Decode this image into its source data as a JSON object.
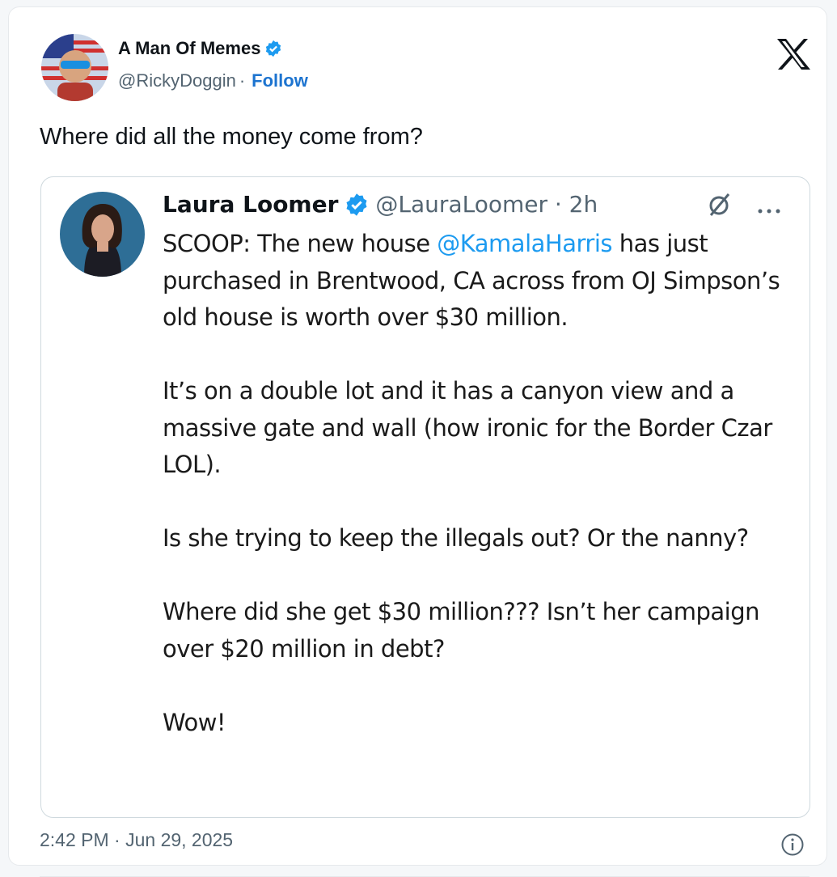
{
  "main_tweet": {
    "author_name": "A Man Of Memes",
    "handle": "@RickyDoggin",
    "separator": "·",
    "follow_label": "Follow",
    "text": "Where did all the money come from?",
    "timestamp": "2:42 PM · Jun 29, 2025"
  },
  "quoted_tweet": {
    "author_name": "Laura Loomer",
    "handle_time": "@LauraLoomer · 2h",
    "body_line1_prefix": "SCOOP: The new house ",
    "mention": "@KamalaHarris",
    "body_line1_suffix": " has",
    "body_para1_rest": "just purchased in Brentwood, CA across from OJ Simpson’s old house is worth over $30 million.",
    "body_para2": "It’s on a double lot and it has a canyon view and a massive gate and wall (how ironic for the Border Czar LOL).",
    "body_para3": "Is she trying to keep the illegals out? Or the nanny?",
    "body_para4": "Where did she get $30 million??? Isn’t her campaign over $20 million in debt?",
    "body_para5": "Wow!"
  },
  "icons": {
    "platform_logo": "x-logo-icon",
    "verified": "verified-badge-icon",
    "grok": "grok-icon",
    "more": "more-icon",
    "info": "info-icon"
  },
  "colors": {
    "link_blue": "#1d9bf0",
    "follow_blue": "#1d74d0",
    "secondary_text": "#536471"
  }
}
